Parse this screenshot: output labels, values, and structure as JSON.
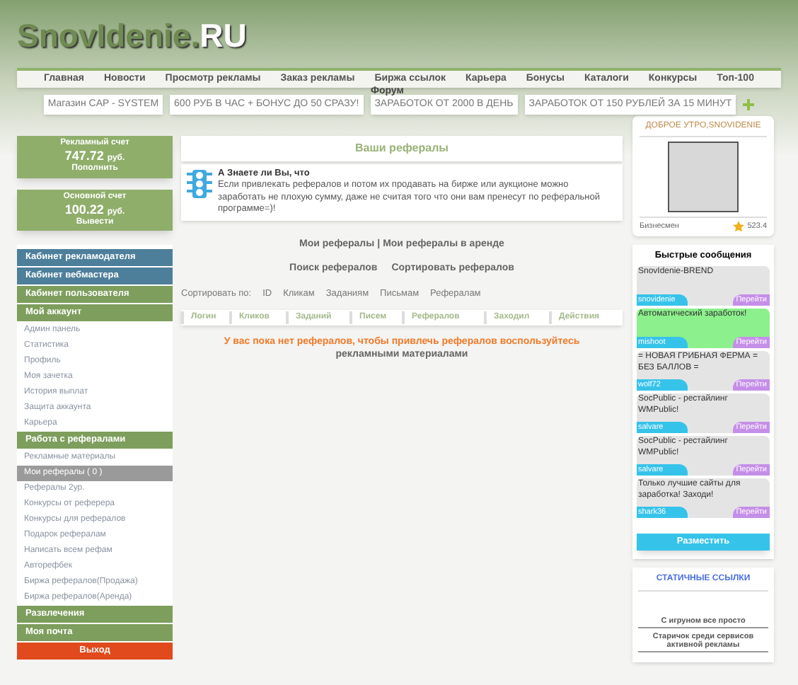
{
  "logo": {
    "main": "SnovIdenie.",
    "suffix": "RU"
  },
  "nav": [
    "Главная",
    "Новости",
    "Просмотр рекламы",
    "Заказ рекламы",
    "Биржа ссылок",
    "Карьера",
    "Бонусы",
    "Каталоги",
    "Конкурсы",
    "Топ-100"
  ],
  "nav_extra": "Форум",
  "banners": [
    "Магазин CAP - SYSTEM",
    "600 РУБ В ЧАС + БОНУС ДО 50 СРАЗУ!",
    "ЗАРАБОТОК ОТ 2000 В ДЕНЬ",
    "ЗАРАБОТОК ОТ 150 РУБЛЕЙ ЗА 15 МИНУТ"
  ],
  "accounts": [
    {
      "title": "Рекламный счет",
      "amount": "747.72",
      "unit": "руб.",
      "action": "Пополнить"
    },
    {
      "title": "Основной счет",
      "amount": "100.22",
      "unit": "руб.",
      "action": "Вывести"
    }
  ],
  "menu": [
    {
      "kind": "header",
      "color": "#4d7f9a",
      "label": "Кабинет рекламодателя"
    },
    {
      "kind": "header",
      "color": "#4d7f9a",
      "label": "Кабинет вебмастера"
    },
    {
      "kind": "header",
      "color": "#7d9e5c",
      "label": "Кабинет пользователя"
    },
    {
      "kind": "header",
      "color": "#7d9e5c",
      "label": "Мой аккаунт"
    },
    {
      "kind": "link",
      "label": "Админ панель",
      "selected": false
    },
    {
      "kind": "link",
      "label": "Статистика",
      "selected": false
    },
    {
      "kind": "link",
      "label": "Профиль",
      "selected": false
    },
    {
      "kind": "link",
      "label": "Моя зачетка",
      "selected": false
    },
    {
      "kind": "link",
      "label": "История выплат",
      "selected": false
    },
    {
      "kind": "link",
      "label": "Защита аккаунта",
      "selected": false
    },
    {
      "kind": "link",
      "label": "Карьера",
      "selected": false
    },
    {
      "kind": "header",
      "color": "#7d9e5c",
      "label": "Работа с рефералами"
    },
    {
      "kind": "link",
      "label": "Рекламные материалы",
      "selected": false
    },
    {
      "kind": "link",
      "label": "Мои рефералы ( 0 )",
      "selected": true
    },
    {
      "kind": "link",
      "label": "Рефералы 2ур.",
      "selected": false
    },
    {
      "kind": "link",
      "label": "Конкурсы от реферера",
      "selected": false
    },
    {
      "kind": "link",
      "label": "Конкурсы для рефералов",
      "selected": false
    },
    {
      "kind": "link",
      "label": "Подарок рефералам",
      "selected": false
    },
    {
      "kind": "link",
      "label": "Написать всем рефам",
      "selected": false
    },
    {
      "kind": "link",
      "label": "Авторефбек",
      "selected": false
    },
    {
      "kind": "link",
      "label": "Биржа рефералов(Продажа)",
      "selected": false
    },
    {
      "kind": "link",
      "label": "Биржа рефералов(Аренда)",
      "selected": false
    },
    {
      "kind": "header",
      "color": "#7d9e5c",
      "label": "Развлечения"
    },
    {
      "kind": "header",
      "color": "#7d9e5c",
      "label": "Моя почта"
    },
    {
      "kind": "exit",
      "color": "#e04a1c",
      "label": "Выход"
    }
  ],
  "page_title": "Ваши рефералы",
  "tip": {
    "title": "А Знаете ли Вы, что",
    "text": "Если привлекать рефералов и потом их продавать на бирже или аукционе можно заработать не плохую сумму, даже не считая того что они вам пренесут по реферальной программе=)!"
  },
  "ref_links": {
    "mine": "Мои рефералы",
    "separator": "|",
    "rented": "Мои рефералы в аренде"
  },
  "actions": [
    "Поиск рефералов",
    "Сортировать рефералов"
  ],
  "sort": {
    "label": "Сортировать по:",
    "options": [
      "ID",
      "Кликам",
      "Заданиям",
      "Письмам",
      "Рефералам"
    ]
  },
  "table": {
    "columns": [
      "Логин",
      "Кликов",
      "Заданий",
      "Писем",
      "Рефералов",
      "Заходил",
      "Действия"
    ]
  },
  "empty_message": {
    "text": "У вас пока нет рефералов, чтобы привлечь рефералов воспользуйтесь",
    "link": "рекламными материалами"
  },
  "profile": {
    "greeting": "ДОБРОЕ УТРО,SNOVIDENIE",
    "status": "Бизнесмен",
    "rating": "523.4"
  },
  "quick_messages": {
    "title": "Быстрые сообщения",
    "items": [
      {
        "text": "SnovIdenie-BREND",
        "user": "snovidenie",
        "action": "Перейти",
        "highlighted": false
      },
      {
        "text": "Автоматический заработок!",
        "user": "mishoot",
        "action": "Перейти",
        "highlighted": true
      },
      {
        "text": "= НОВАЯ ГРИБНАЯ ФЕРМА = БЕЗ БАЛЛОВ =",
        "user": "wolf72",
        "action": "Перейти",
        "highlighted": false
      },
      {
        "text": "SocPublic - рестайлинг WMPublic!",
        "user": "salvare",
        "action": "Перейти",
        "highlighted": false
      },
      {
        "text": "SocPublic - рестайлинг WMPublic!",
        "user": "salvare",
        "action": "Перейти",
        "highlighted": false
      },
      {
        "text": "Только лучшие сайты для заработка! Заходи!",
        "user": "shark36",
        "action": "Перейти",
        "highlighted": false
      }
    ],
    "post": "Разместить"
  },
  "static_links": {
    "title": "СТАТИЧНЫЕ ССЫЛКИ",
    "items": [
      "С игруном все просто",
      "Старичок среди сервисов активной рекламы"
    ]
  }
}
